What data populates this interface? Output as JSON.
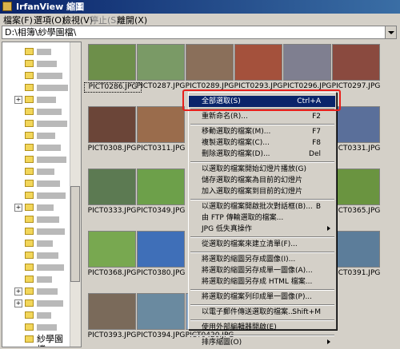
{
  "window": {
    "title": "IrfanView 縮圖"
  },
  "menu": [
    {
      "label": "檔案(F)",
      "disabled": false
    },
    {
      "label": "選項(O)",
      "disabled": false
    },
    {
      "label": "檢視(V)",
      "disabled": false
    },
    {
      "label": "停止(S)",
      "disabled": true
    },
    {
      "label": "離開(X)",
      "disabled": false
    }
  ],
  "path": {
    "value": "D:\\相簿\\紗學園檔\\"
  },
  "tree": {
    "items": [
      {
        "expand": false,
        "label": ""
      },
      {
        "expand": false,
        "label": ""
      },
      {
        "expand": false,
        "label": ""
      },
      {
        "expand": false,
        "label": ""
      },
      {
        "expand": true,
        "label": ""
      },
      {
        "expand": false,
        "label": ""
      },
      {
        "expand": false,
        "label": ""
      },
      {
        "expand": false,
        "label": ""
      },
      {
        "expand": false,
        "label": ""
      },
      {
        "expand": false,
        "label": ""
      },
      {
        "expand": false,
        "label": ""
      },
      {
        "expand": false,
        "label": ""
      },
      {
        "expand": false,
        "label": ""
      },
      {
        "expand": true,
        "label": ""
      },
      {
        "expand": false,
        "label": ""
      },
      {
        "expand": false,
        "label": ""
      },
      {
        "expand": false,
        "label": ""
      },
      {
        "expand": false,
        "label": ""
      },
      {
        "expand": false,
        "label": ""
      },
      {
        "expand": false,
        "label": ""
      },
      {
        "expand": true,
        "label": ""
      },
      {
        "expand": true,
        "label": ""
      },
      {
        "expand": false,
        "label": ""
      },
      {
        "expand": false,
        "label": ""
      },
      {
        "expand": false,
        "label": "紗學園檔"
      }
    ]
  },
  "thumbnails": [
    {
      "name": "PICT0286.JPG",
      "color": "#6d8f4a",
      "selected": true
    },
    {
      "name": "PICT0287.JPG",
      "color": "#7a9a66",
      "selected": false
    },
    {
      "name": "PICT0289.JPG",
      "color": "#8a6f5a",
      "selected": false
    },
    {
      "name": "PICT0293.JPG",
      "color": "#a4513c",
      "selected": false
    },
    {
      "name": "PICT0296.JPG",
      "color": "#7f7f90",
      "selected": false
    },
    {
      "name": "PICT0297.JPG",
      "color": "#8a4a3f",
      "selected": false
    },
    {
      "name": "PICT0308.JPG",
      "color": "#6b4538",
      "selected": false
    },
    {
      "name": "PICT0311.JPG",
      "color": "#9a6c4c",
      "selected": false
    },
    {
      "name": "",
      "color": "#d4d0c8",
      "selected": false
    },
    {
      "name": "",
      "color": "#d4d0c8",
      "selected": false
    },
    {
      "name": "",
      "color": "#d4d0c8",
      "selected": false
    },
    {
      "name": "PICT0331.JPG",
      "color": "#5a6f9a",
      "selected": false
    },
    {
      "name": "PICT0333.JPG",
      "color": "#5c7a52",
      "selected": false
    },
    {
      "name": "PICT0349.JPG",
      "color": "#6da04a",
      "selected": false
    },
    {
      "name": "",
      "color": "#d4d0c8",
      "selected": false
    },
    {
      "name": "",
      "color": "#d4d0c8",
      "selected": false
    },
    {
      "name": "",
      "color": "#d4d0c8",
      "selected": false
    },
    {
      "name": "PICT0365.JPG",
      "color": "#6a9440",
      "selected": false
    },
    {
      "name": "PICT0368.JPG",
      "color": "#78a850",
      "selected": false
    },
    {
      "name": "PICT0380.JPG",
      "color": "#3f6fb8",
      "selected": false
    },
    {
      "name": "",
      "color": "#d4d0c8",
      "selected": false
    },
    {
      "name": "",
      "color": "#d4d0c8",
      "selected": false
    },
    {
      "name": "",
      "color": "#d4d0c8",
      "selected": false
    },
    {
      "name": "PICT0391.JPG",
      "color": "#5c7d9a",
      "selected": false
    },
    {
      "name": "PICT0393.JPG",
      "color": "#7a6a5a",
      "selected": false
    },
    {
      "name": "PICT0394.JPG",
      "color": "#6a8aa0",
      "selected": false
    },
    {
      "name": "PICT0420.JPG",
      "color": "#8aa8c8",
      "selected": false
    },
    {
      "name": "",
      "color": "#d4d0c8",
      "selected": false
    },
    {
      "name": "",
      "color": "#d4d0c8",
      "selected": false
    },
    {
      "name": "",
      "color": "#d4d0c8",
      "selected": false
    }
  ],
  "context_menu": {
    "items": [
      {
        "type": "item",
        "label": "全部選取(S)",
        "shortcut": "Ctrl+A",
        "highlight": true
      },
      {
        "type": "sep"
      },
      {
        "type": "item",
        "label": "重新命名(R)...",
        "shortcut": "F2"
      },
      {
        "type": "sep"
      },
      {
        "type": "item",
        "label": "移動選取的檔案(M)...",
        "shortcut": "F7"
      },
      {
        "type": "item",
        "label": "複製選取的檔案(C)...",
        "shortcut": "F8"
      },
      {
        "type": "item",
        "label": "刪除選取的檔案(D)...",
        "shortcut": "Del"
      },
      {
        "type": "sep"
      },
      {
        "type": "item",
        "label": "以選取的檔案開始幻燈片播放(G)"
      },
      {
        "type": "item",
        "label": "儲存選取的檔案為目前的幻燈片"
      },
      {
        "type": "item",
        "label": "加入選取的檔案到目前的幻燈片"
      },
      {
        "type": "sep"
      },
      {
        "type": "item",
        "label": "以選取的檔案開啟批次對話框(B)...",
        "shortcut": "B"
      },
      {
        "type": "item",
        "label": "由 FTP 傳輸選取的檔案..."
      },
      {
        "type": "item",
        "label": "JPG 低失真操作",
        "submenu": true
      },
      {
        "type": "sep"
      },
      {
        "type": "item",
        "label": "從選取的檔案來建立清單(F)..."
      },
      {
        "type": "sep"
      },
      {
        "type": "item",
        "label": "將選取的縮圖另存成圖像(I)..."
      },
      {
        "type": "item",
        "label": "將選取的縮圖另存成單一圖像(A)..."
      },
      {
        "type": "item",
        "label": "將選取的縮圖另存成 HTML 檔案..."
      },
      {
        "type": "sep"
      },
      {
        "type": "item",
        "label": "將選取的檔案列印成單一圖像(P)..."
      },
      {
        "type": "sep"
      },
      {
        "type": "item",
        "label": "以電子郵件傳送選取的檔案...",
        "shortcut": "Shift+M"
      },
      {
        "type": "sep"
      },
      {
        "type": "item",
        "label": "使用外部編輯器開啟(E)"
      },
      {
        "type": "sep"
      },
      {
        "type": "item",
        "label": "排序縮圖(O)",
        "submenu": true
      }
    ]
  }
}
